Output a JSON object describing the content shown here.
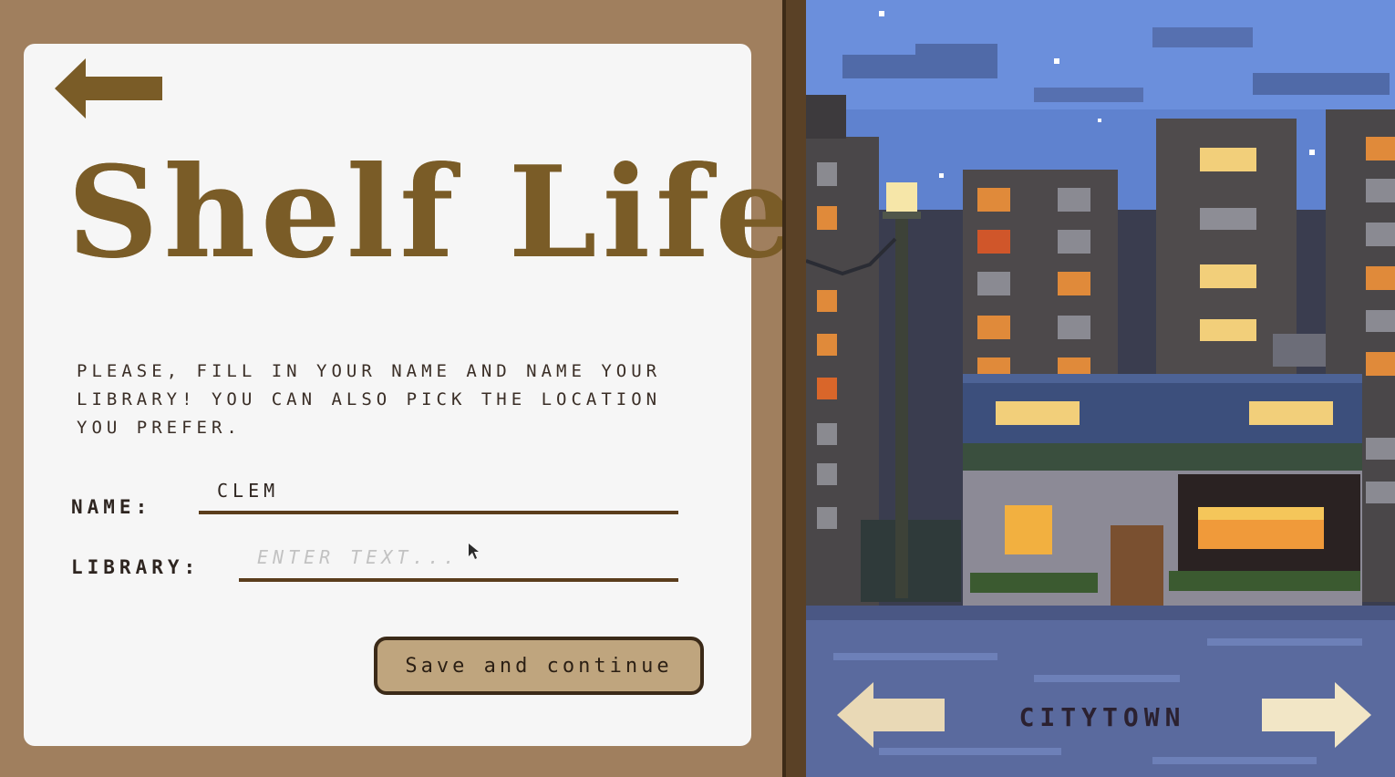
{
  "title": "Shelf Life",
  "instructions": "PLEASE, FILL IN YOUR NAME AND NAME YOUR LIBRARY! YOU CAN ALSO PICK THE LOCATION YOU PREFER.",
  "form": {
    "name_label": "NAME:",
    "name_value": "CLEM",
    "library_label": "LIBRARY:",
    "library_placeholder": "ENTER TEXT...",
    "save_label": "Save and continue"
  },
  "location": {
    "label": "CITYTOWN"
  },
  "icons": {
    "back": "back-arrow-icon",
    "prev_location": "arrow-left-icon",
    "next_location": "arrow-right-icon",
    "cursor": "mouse-cursor-icon"
  },
  "colors": {
    "background": "#a07f5e",
    "card": "#f6f6f6",
    "title": "#7a5c27",
    "button": "#bfa57e",
    "night_sky": "#5c7fcc",
    "arrow_cream": "#e9d9b6"
  }
}
